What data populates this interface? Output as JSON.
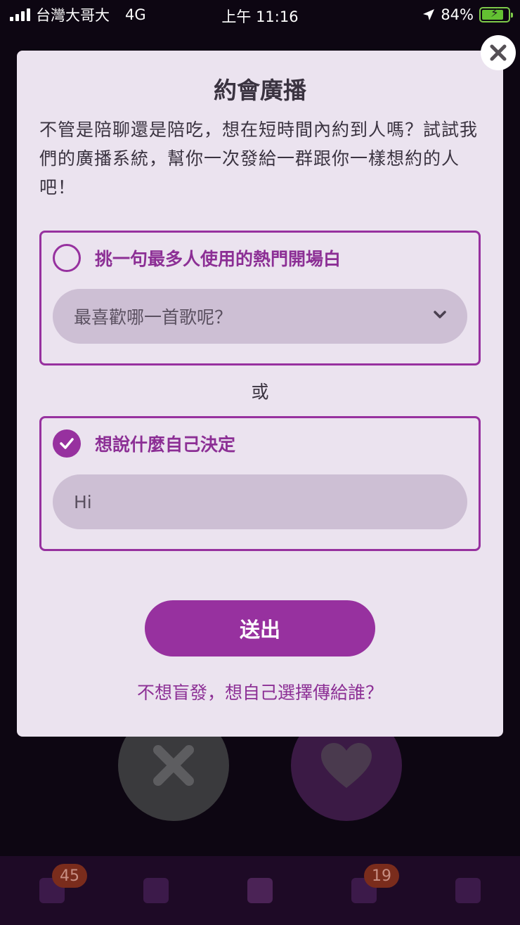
{
  "status_bar": {
    "carrier": "台灣大哥大",
    "network": "4G",
    "time": "上午 11:16",
    "battery": "84%"
  },
  "modal": {
    "title": "約會廣播",
    "description": "不管是陪聊還是陪吃，想在短時間內約到人嗎？試試我們的廣播系統，幫你一次發給一群跟你一樣想約的人吧！",
    "preset_option": {
      "label": "挑一句最多人使用的熱門開場白",
      "selected": false,
      "selected_value": "最喜歡哪一首歌呢？"
    },
    "or_text": "或",
    "custom_option": {
      "label": "想說什麼自己決定",
      "selected": true,
      "input_value": "Hi"
    },
    "submit_label": "送出",
    "choose_link": "不想盲發，想自己選擇傳給誰？"
  },
  "bottom_nav": {
    "badge_1": "45",
    "badge_2": "19"
  },
  "colors": {
    "accent": "#97319f",
    "modal_bg": "#ebe3ef",
    "pill_bg": "#cdbfd4"
  }
}
